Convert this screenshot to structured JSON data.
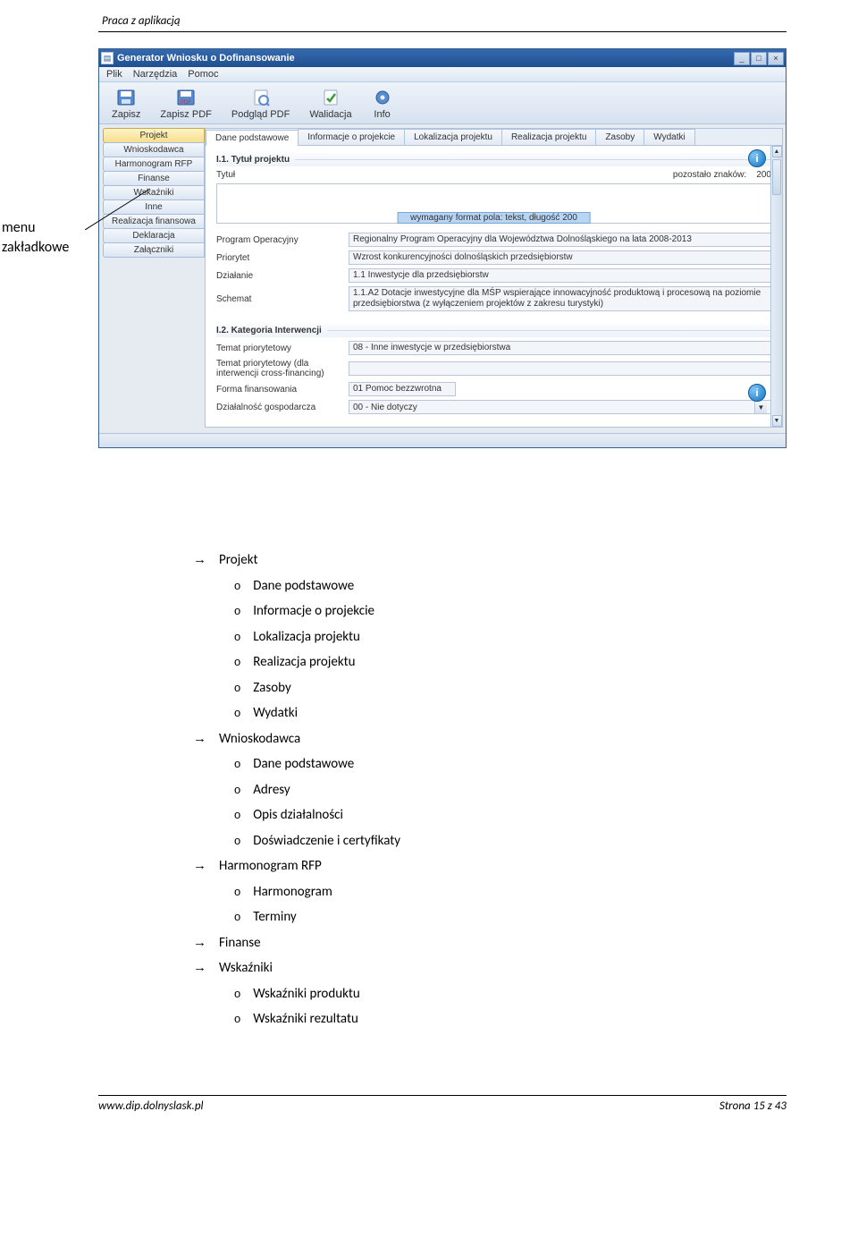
{
  "doc": {
    "header": "Praca z aplikacją",
    "annotation": "menu\nzakładkowe",
    "footer_left": "www.dip.dolnyslask.pl",
    "footer_right": "Strona 15 z 43"
  },
  "app": {
    "title": "Generator Wniosku o Dofinansowanie",
    "window_buttons": {
      "min": "_",
      "max": "□",
      "close": "×"
    },
    "menus": [
      "Plik",
      "Narzędzia",
      "Pomoc"
    ],
    "toolbar": [
      {
        "name": "zapisz",
        "label": "Zapisz"
      },
      {
        "name": "zapisz-pdf",
        "label": "Zapisz PDF"
      },
      {
        "name": "podglad-pdf",
        "label": "Podgląd PDF"
      },
      {
        "name": "walidacja",
        "label": "Walidacja"
      },
      {
        "name": "info",
        "label": "Info"
      }
    ],
    "sidebar": [
      "Projekt",
      "Wnioskodawca",
      "Harmonogram RFP",
      "Finanse",
      "Wskaźniki",
      "Inne",
      "Realizacja finansowa",
      "Deklaracja",
      "Załączniki"
    ],
    "tabs": [
      "Dane podstawowe",
      "Informacje o projekcie",
      "Lokalizacja projektu",
      "Realizacja projektu",
      "Zasoby",
      "Wydatki"
    ],
    "section1": {
      "heading": "I.1. Tytuł projektu",
      "label_tytul": "Tytuł",
      "remaining_prefix": "pozostało znaków:",
      "remaining_value": "200",
      "tooltip": "wymagany format pola: tekst, długość 200",
      "rows": [
        {
          "label": "Program Operacyjny",
          "value": "Regionalny Program Operacyjny dla Województwa Dolnośląskiego na lata 2008-2013"
        },
        {
          "label": "Priorytet",
          "value": "Wzrost konkurencyjności dolnośląskich przedsiębiorstw"
        },
        {
          "label": "Działanie",
          "value": "1.1 Inwestycje dla przedsiębiorstw"
        },
        {
          "label": "Schemat",
          "value": "1.1.A2 Dotacje inwestycyjne dla MŚP wspierające innowacyjność produktową i procesową na poziomie przedsiębiorstwa (z wyłączeniem projektów z zakresu turystyki)"
        }
      ]
    },
    "section2": {
      "heading": "I.2. Kategoria Interwencji",
      "rows": [
        {
          "label": "Temat priorytetowy",
          "value": "08 - Inne inwestycje w przedsiębiorstwa"
        },
        {
          "label": "Temat priorytetowy (dla interwencji cross-financing)",
          "value": ""
        },
        {
          "label": "Forma finansowania",
          "value": "01 Pomoc bezzwrotna"
        },
        {
          "label": "Działalność gospodarcza",
          "value": "00 - Nie dotyczy",
          "dropdown": true
        }
      ]
    }
  },
  "outline": [
    {
      "heading": "Projekt",
      "items": [
        "Dane podstawowe",
        "Informacje o projekcie",
        "Lokalizacja projektu",
        "Realizacja projektu",
        "Zasoby",
        "Wydatki"
      ]
    },
    {
      "heading": "Wnioskodawca",
      "items": [
        "Dane podstawowe",
        "Adresy",
        "Opis działalności",
        "Doświadczenie i certyfikaty"
      ]
    },
    {
      "heading": "Harmonogram RFP",
      "items": [
        "Harmonogram",
        "Terminy"
      ]
    },
    {
      "heading": "Finanse",
      "items": []
    },
    {
      "heading": "Wskaźniki",
      "items": [
        "Wskaźniki produktu",
        "Wskaźniki rezultatu"
      ]
    }
  ]
}
